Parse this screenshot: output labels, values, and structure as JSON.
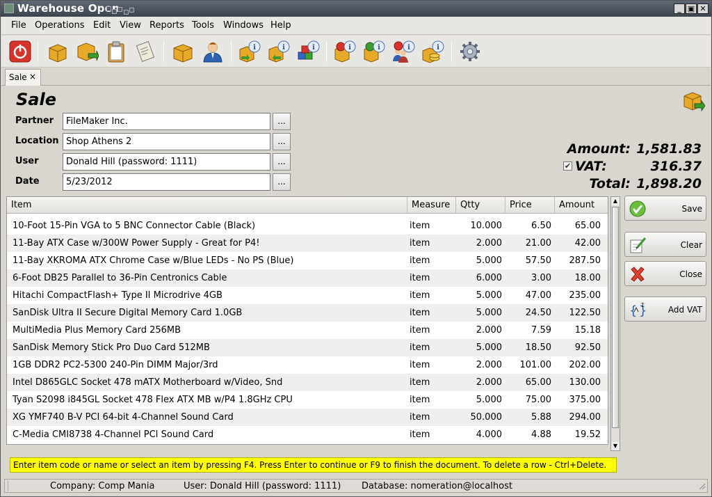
{
  "window": {
    "title": "Warehouse Open"
  },
  "menu": [
    "File",
    "Operations",
    "Edit",
    "View",
    "Reports",
    "Tools",
    "Windows",
    "Help"
  ],
  "toolbar_icons": [
    "power-icon",
    "box-open-icon",
    "box-forward-icon",
    "clipboard-icon",
    "scroll-icon",
    "box-icon",
    "user-icon",
    "box-info-icon",
    "box-info-2-icon",
    "cubes-info-icon",
    "box-info-red-icon",
    "box-info-green-icon",
    "users-info-icon",
    "coins-info-icon",
    "gear-icon"
  ],
  "tab": {
    "label": "Sale",
    "close": "×"
  },
  "document": {
    "title": "Sale"
  },
  "fields": {
    "partner_label": "Partner",
    "partner": "FileMaker Inc.",
    "location_label": "Location",
    "location": "Shop Athens 2",
    "user_label": "User",
    "user": "Donald Hill (password: 1111)",
    "date_label": "Date",
    "date": "5/23/2012",
    "browse": "..."
  },
  "totals": {
    "amount_label": "Amount:",
    "amount": "1,581.83",
    "vat_label": "VAT:",
    "vat": "316.37",
    "vat_checked": true,
    "total_label": "Total:",
    "total": "1,898.20"
  },
  "grid": {
    "columns": [
      "Item",
      "Measure",
      "Qtty",
      "Price",
      "Amount"
    ],
    "rows": [
      [
        "10-Foot 15-Pin VGA to 5 BNC Connector Cable (Black)",
        "item",
        "10.000",
        "6.50",
        "65.00"
      ],
      [
        "11-Bay ATX Case w/300W Power Supply - Great for P4!",
        "item",
        "2.000",
        "21.00",
        "42.00"
      ],
      [
        "11-Bay XKROMA ATX Chrome Case w/Blue LEDs - No PS (Blue)",
        "item",
        "5.000",
        "57.50",
        "287.50"
      ],
      [
        "6-Foot DB25 Parallel to 36-Pin Centronics Cable",
        "item",
        "6.000",
        "3.00",
        "18.00"
      ],
      [
        "Hitachi CompactFlash+ Type II Microdrive 4GB",
        "item",
        "5.000",
        "47.00",
        "235.00"
      ],
      [
        "SanDisk Ultra II Secure Digital Memory Card 1.0GB",
        "item",
        "5.000",
        "24.50",
        "122.50"
      ],
      [
        "MultiMedia Plus Memory Card 256MB",
        "item",
        "2.000",
        "7.59",
        "15.18"
      ],
      [
        "SanDisk Memory Stick Pro Duo Card 512MB",
        "item",
        "5.000",
        "18.50",
        "92.50"
      ],
      [
        "1GB DDR2 PC2-5300 240-Pin DIMM Major/3rd",
        "item",
        "2.000",
        "101.00",
        "202.00"
      ],
      [
        "Intel D865GLC Socket 478 mATX Motherboard w/Video, Snd",
        "item",
        "2.000",
        "65.00",
        "130.00"
      ],
      [
        "Tyan S2098 i845GL Socket 478 Flex ATX MB w/P4 1.8GHz CPU",
        "item",
        "5.000",
        "75.00",
        "375.00"
      ],
      [
        "XG YMF740 B-V PCI 64-bit 4-Channel Sound Card",
        "item",
        "50.000",
        "5.88",
        "294.00"
      ],
      [
        "C-Media CMI8738 4-Channel PCI Sound Card",
        "item",
        "4.000",
        "4.88",
        "19.52"
      ]
    ]
  },
  "actions": {
    "save": "Save",
    "clear": "Clear",
    "close": "Close",
    "add_vat": "Add VAT"
  },
  "hint": "Enter item code or name or select an item by pressing F4. Press Enter to continue or F9 to finish the document. To delete a row - Ctrl+Delete.",
  "status": {
    "company": "Company: Comp Mania",
    "user": "User: Donald Hill (password: 1111)",
    "database": "Database: nomeration@localhost"
  }
}
